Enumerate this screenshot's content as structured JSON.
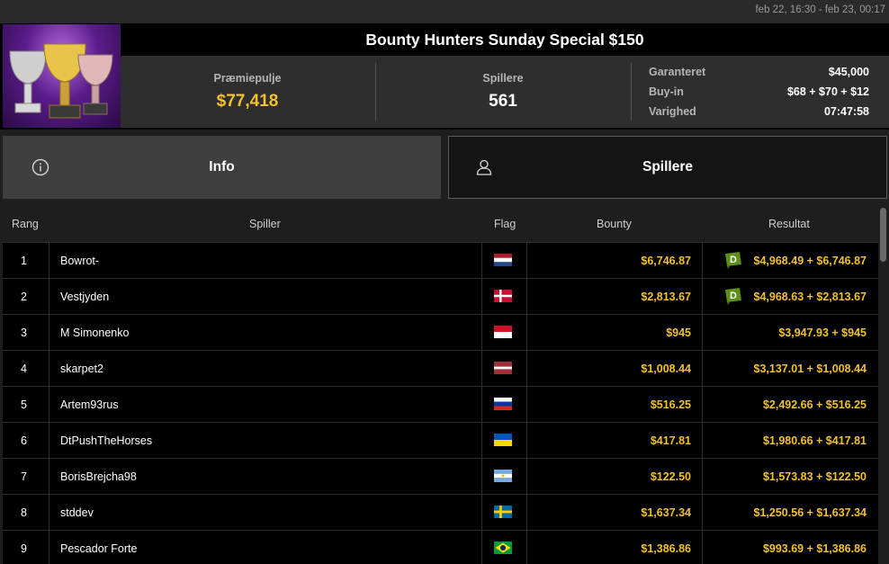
{
  "header": {
    "date_range": "feb 22, 16:30 - feb 23, 00:17",
    "title": "Bounty Hunters Sunday Special $150",
    "prize_label": "Præmiepulje",
    "prize_value": "$77,418",
    "players_label": "Spillere",
    "players_value": "561",
    "info": [
      {
        "k": "Garanteret",
        "v": "$45,000"
      },
      {
        "k": "Buy-in",
        "v": "$68 + $70 + $12"
      },
      {
        "k": "Varighed",
        "v": "07:47:58"
      }
    ]
  },
  "tabs": {
    "info": "Info",
    "players": "Spillere"
  },
  "table": {
    "headers": {
      "rank": "Rang",
      "player": "Spiller",
      "flag": "Flag",
      "bounty": "Bounty",
      "result": "Resultat"
    },
    "rows": [
      {
        "rank": "1",
        "player": "Bowrot-",
        "flag": "NL",
        "bounty": "$6,746.87",
        "result": "$4,968.49 + $6,746.87",
        "badge": true
      },
      {
        "rank": "2",
        "player": "Vestjyden",
        "flag": "DK",
        "bounty": "$2,813.67",
        "result": "$4,968.63 + $2,813.67",
        "badge": true
      },
      {
        "rank": "3",
        "player": "M Simonenko",
        "flag": "ID",
        "bounty": "$945",
        "result": "$3,947.93 + $945",
        "badge": false
      },
      {
        "rank": "4",
        "player": "skarpet2",
        "flag": "LV",
        "bounty": "$1,008.44",
        "result": "$3,137.01 + $1,008.44",
        "badge": false
      },
      {
        "rank": "5",
        "player": "Artem93rus",
        "flag": "RU",
        "bounty": "$516.25",
        "result": "$2,492.66 + $516.25",
        "badge": false
      },
      {
        "rank": "6",
        "player": "DtPushTheHorses",
        "flag": "UA",
        "bounty": "$417.81",
        "result": "$1,980.66 + $417.81",
        "badge": false
      },
      {
        "rank": "7",
        "player": "BorisBrejcha98",
        "flag": "AR",
        "bounty": "$122.50",
        "result": "$1,573.83 + $122.50",
        "badge": false
      },
      {
        "rank": "8",
        "player": "stddev",
        "flag": "SE",
        "bounty": "$1,637.34",
        "result": "$1,250.56 + $1,637.34",
        "badge": false
      },
      {
        "rank": "9",
        "player": "Pescador Forte",
        "flag": "BR",
        "bounty": "$1,386.86",
        "result": "$993.69 + $1,386.86",
        "badge": false
      }
    ]
  },
  "colors": {
    "accent_gold": "#f2c12e",
    "badge_green": "#5a8f1c"
  },
  "icons": {
    "info_tab": "info-circle-icon",
    "players_tab": "user-icon",
    "badge": "d-badge-icon"
  }
}
